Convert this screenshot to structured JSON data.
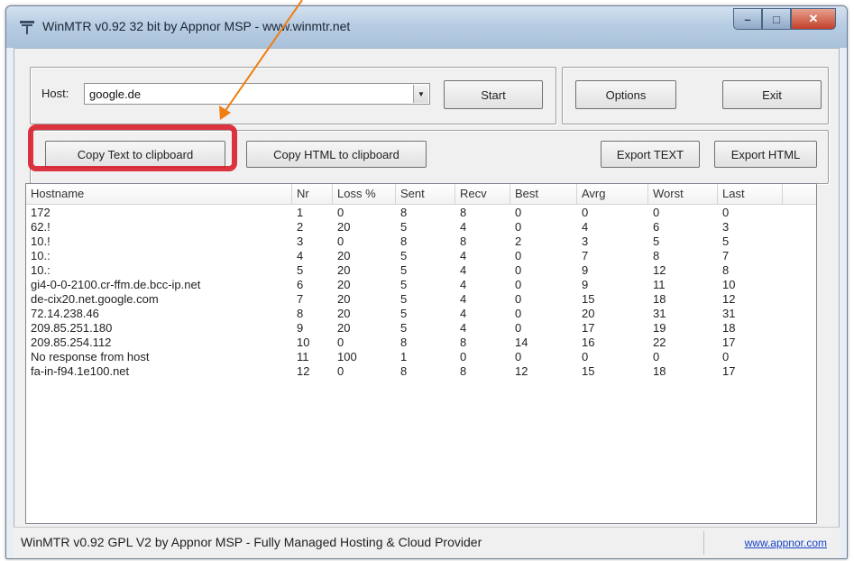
{
  "window": {
    "title": "WinMTR v0.92 32 bit by Appnor MSP - www.winmtr.net",
    "controls": {
      "minimize": "–",
      "maximize": "□",
      "close": "✕"
    }
  },
  "host": {
    "label": "Host:",
    "value": "google.de"
  },
  "buttons": {
    "start": "Start",
    "options": "Options",
    "exit": "Exit",
    "copy_text": "Copy Text to clipboard",
    "copy_html": "Copy HTML to clipboard",
    "export_text": "Export TEXT",
    "export_html": "Export HTML"
  },
  "table": {
    "columns": [
      "Hostname",
      "Nr",
      "Loss %",
      "Sent",
      "Recv",
      "Best",
      "Avrg",
      "Worst",
      "Last"
    ],
    "rows": [
      [
        "172",
        "1",
        "0",
        "8",
        "8",
        "0",
        "0",
        "0",
        "0"
      ],
      [
        "62.!",
        "2",
        "20",
        "5",
        "4",
        "0",
        "4",
        "6",
        "3"
      ],
      [
        "10.!",
        "3",
        "0",
        "8",
        "8",
        "2",
        "3",
        "5",
        "5"
      ],
      [
        "10.:",
        "4",
        "20",
        "5",
        "4",
        "0",
        "7",
        "8",
        "7"
      ],
      [
        "10.:",
        "5",
        "20",
        "5",
        "4",
        "0",
        "9",
        "12",
        "8"
      ],
      [
        "gi4-0-0-2100.cr-ffm.de.bcc-ip.net",
        "6",
        "20",
        "5",
        "4",
        "0",
        "9",
        "11",
        "10"
      ],
      [
        "de-cix20.net.google.com",
        "7",
        "20",
        "5",
        "4",
        "0",
        "15",
        "18",
        "12"
      ],
      [
        "72.14.238.46",
        "8",
        "20",
        "5",
        "4",
        "0",
        "20",
        "31",
        "31"
      ],
      [
        "209.85.251.180",
        "9",
        "20",
        "5",
        "4",
        "0",
        "17",
        "19",
        "18"
      ],
      [
        "209.85.254.112",
        "10",
        "0",
        "8",
        "8",
        "14",
        "16",
        "22",
        "17"
      ],
      [
        "No response from host",
        "11",
        "100",
        "1",
        "0",
        "0",
        "0",
        "0",
        "0"
      ],
      [
        "fa-in-f94.1e100.net",
        "12",
        "0",
        "8",
        "8",
        "12",
        "15",
        "18",
        "17"
      ]
    ]
  },
  "status": {
    "text": "WinMTR v0.92 GPL V2 by Appnor MSP - Fully Managed Hosting & Cloud Provider",
    "link": "www.appnor.com"
  },
  "colors": {
    "highlight": "#d81f2c",
    "arrow": "#f07d12",
    "link": "#1a43c6"
  }
}
